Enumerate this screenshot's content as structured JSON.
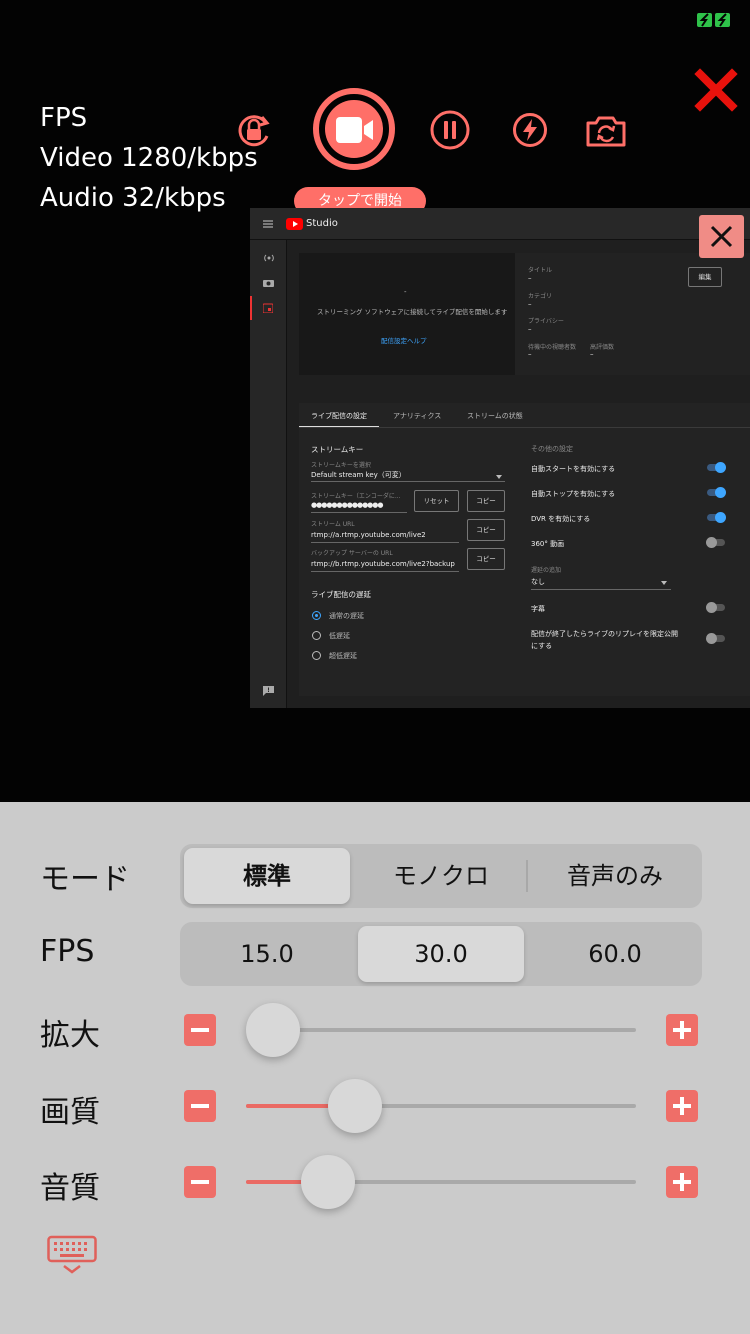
{
  "stats": {
    "fps": "FPS",
    "video": "Video 1280/kbps",
    "audio": "Audio 32/kbps"
  },
  "toolbar": {
    "icons": [
      "rotation-lock-icon",
      "video-camera-icon",
      "pause-icon",
      "flash-icon",
      "switch-camera-icon",
      "close-icon"
    ],
    "tap_to_start": "タップで開始"
  },
  "colors": {
    "accent": "#ff6f68",
    "close_red": "#e8120c",
    "battery": "#2fc24a",
    "panel_bg": "#cbcbcb"
  },
  "studio": {
    "brand": "Studio",
    "stream_hint": "ストリーミング ソフトウェアに接続してライブ配信を開始します",
    "dash": "-",
    "help_link": "配信設定ヘルプ",
    "info": {
      "title_label": "タイトル",
      "title_value": "–",
      "category_label": "カテゴリ",
      "category_value": "–",
      "privacy_label": "プライバシー",
      "privacy_value": "–",
      "waiting_label": "待機中の視聴者数",
      "waiting_value": "–",
      "likes_label": "高評価数",
      "likes_value": "–",
      "edit_button": "編集"
    },
    "tabs": [
      "ライブ配信の設定",
      "アナリティクス",
      "ストリームの状態"
    ],
    "stream_key": {
      "section": "ストリームキー",
      "select_label": "ストリームキーを選択",
      "select_value": "Default stream key（可変）",
      "key_label": "ストリームキー（エンコーダに...",
      "key_value": "●●●●●●●●●●●●●●",
      "reset": "リセット",
      "copy": "コピー",
      "url_label": "ストリーム URL",
      "url_value": "rtmp://a.rtmp.youtube.com/live2",
      "backup_label": "バックアップ サーバーの URL",
      "backup_value": "rtmp://b.rtmp.youtube.com/live2?backup"
    },
    "latency": {
      "section": "ライブ配信の遅延",
      "options": [
        "通常の遅延",
        "低遅延",
        "超低遅延"
      ]
    },
    "other": {
      "section": "その他の設定",
      "auto_start": "自動スタートを有効にする",
      "auto_stop": "自動ストップを有効にする",
      "dvr": "DVR を有効にする",
      "vr360": "360° 動画",
      "delay_label": "遅延の追加",
      "delay_value": "なし",
      "captions": "字幕",
      "replay_line1": "配信が終了したらライブのリプレイを限定公開",
      "replay_line2": "にする"
    }
  },
  "settings": {
    "mode": {
      "label": "モード",
      "options": [
        "標準",
        "モノクロ",
        "音声のみ"
      ],
      "selected": 0
    },
    "fps": {
      "label": "FPS",
      "options": [
        "15.0",
        "30.0",
        "60.0"
      ],
      "selected": 1
    },
    "zoom": {
      "label": "拡大",
      "value": 0.0
    },
    "quality": {
      "label": "画質",
      "value": 0.28
    },
    "audio_quality": {
      "label": "音質",
      "value": 0.21
    },
    "keyboard_icon": "keyboard-icon"
  }
}
